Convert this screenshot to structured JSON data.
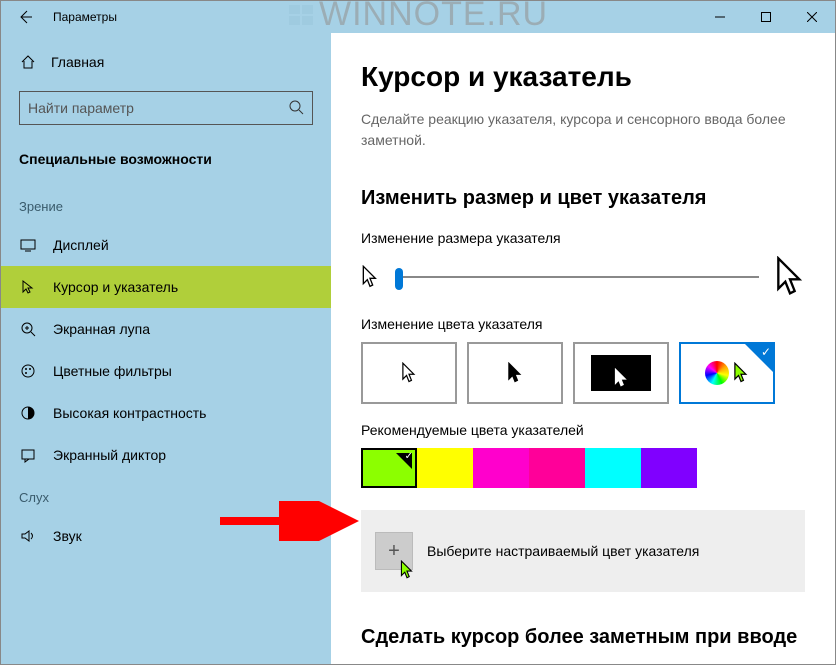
{
  "window": {
    "title": "Параметры"
  },
  "watermark": "WINNOTE.RU",
  "sidebar": {
    "home": "Главная",
    "search_placeholder": "Найти параметр",
    "section": "Специальные возможности",
    "groups": [
      {
        "label": "Зрение",
        "items": [
          {
            "label": "Дисплей",
            "icon": "display"
          },
          {
            "label": "Курсор и указатель",
            "icon": "cursor",
            "active": true
          },
          {
            "label": "Экранная лупа",
            "icon": "magnifier"
          },
          {
            "label": "Цветные фильтры",
            "icon": "palette"
          },
          {
            "label": "Высокая контрастность",
            "icon": "contrast"
          },
          {
            "label": "Экранный диктор",
            "icon": "narrator"
          }
        ]
      },
      {
        "label": "Слух",
        "items": [
          {
            "label": "Звук",
            "icon": "sound"
          }
        ]
      }
    ]
  },
  "content": {
    "heading": "Курсор и указатель",
    "description": "Сделайте реакцию указателя, курсора и сенсорного ввода более заметной.",
    "section1": "Изменить размер и цвет указателя",
    "size_label": "Изменение размера указателя",
    "color_label": "Изменение цвета указателя",
    "rec_label": "Рекомендуемые цвета указателей",
    "rec_colors": [
      "#8CFF00",
      "#FFFF00",
      "#FF00CC",
      "#FF0099",
      "#00FFFF",
      "#8000FF"
    ],
    "selected_rec": 0,
    "custom_label": "Выберите настраиваемый цвет указателя",
    "section2": "Сделать курсор более заметным при вводе"
  }
}
